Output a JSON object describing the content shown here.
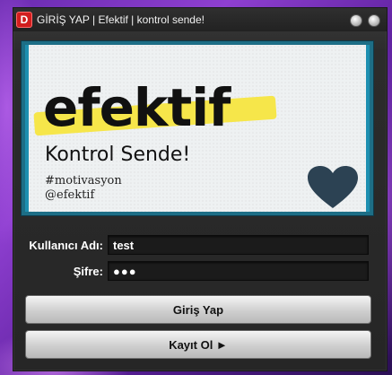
{
  "window": {
    "title": "GİRİŞ YAP | Efektif | kontrol sende!",
    "app_icon_letter": "D"
  },
  "banner": {
    "brand": "efektif",
    "tagline": "Kontrol Sende!",
    "hashtag": "#motivasyon",
    "handle": "@efektif",
    "colors": {
      "highlight": "#f6e64a",
      "heart": "#2c4253",
      "frame": "#1d8fb0"
    }
  },
  "form": {
    "username_label": "Kullanıcı Adı:",
    "username_value": "test",
    "password_label": "Şifre:",
    "password_value": "●●●"
  },
  "buttons": {
    "login_label": "Giriş Yap",
    "register_label": "Kayıt Ol ►"
  }
}
